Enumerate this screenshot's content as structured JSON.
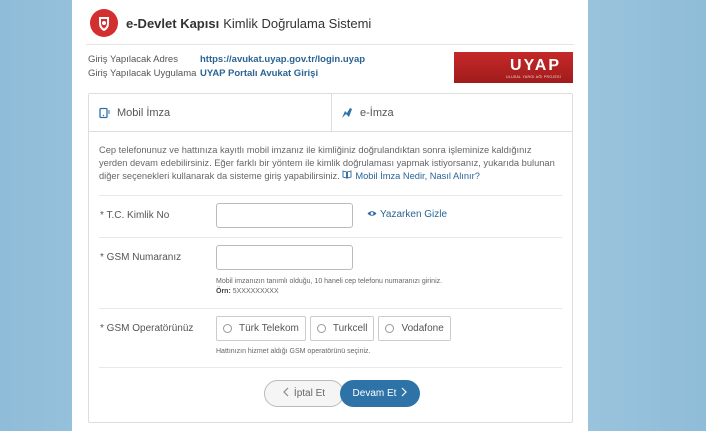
{
  "header": {
    "brand_strong": "e-Devlet Kapısı",
    "brand_rest": "Kimlik Doğrulama Sistemi"
  },
  "info": {
    "address_label": "Giriş Yapılacak Adres",
    "address_value": "https://avukat.uyap.gov.tr/login.uyap",
    "app_label": "Giriş Yapılacak Uygulama",
    "app_value": "UYAP Portalı Avukat Girişi"
  },
  "uyap_logo": {
    "text": "UYAP",
    "sub": "ULUSAL YARGI AĞI PROJESİ"
  },
  "tabs": [
    {
      "label": "Mobil İmza",
      "icon": "mobile-signature-icon"
    },
    {
      "label": "e-İmza",
      "icon": "e-signature-icon"
    }
  ],
  "description": {
    "text": "Cep telefonunuz ve hattınıza kayıtlı mobil imzanız ile kimliğiniz doğrulandıktan sonra işleminize kaldığınız yerden devam edebilirsiniz. Eğer farklı bir yöntem ile kimlik doğrulaması yapmak istiyorsanız, yukarıda bulunan diğer seçenekleri kullanarak da sisteme giriş yapabilirsiniz.",
    "help_link": "Mobil İmza Nedir, Nasıl Alınır?"
  },
  "fields": {
    "tc_label": "* T.C. Kimlik No",
    "tc_value": "",
    "hide_link": "Yazarken Gizle",
    "gsm_label": "* GSM Numaranız",
    "gsm_value": "",
    "gsm_hint": "Mobil imzanızın tanımlı olduğu, 10 haneli cep telefonu numaranızı giriniz.",
    "gsm_example_label": "Örn:",
    "gsm_example_value": "5XXXXXXXXX",
    "operator_label": "* GSM Operatörünüz",
    "operators": [
      "Türk Telekom",
      "Turkcell",
      "Vodafone"
    ],
    "operator_hint": "Hattınızın hizmet aldığı GSM operatörünü seçiniz."
  },
  "buttons": {
    "cancel": "İptal Et",
    "next": "Devam Et"
  },
  "colors": {
    "accent": "#2d73a8",
    "link": "#2a6496",
    "brand_red": "#c62828"
  }
}
